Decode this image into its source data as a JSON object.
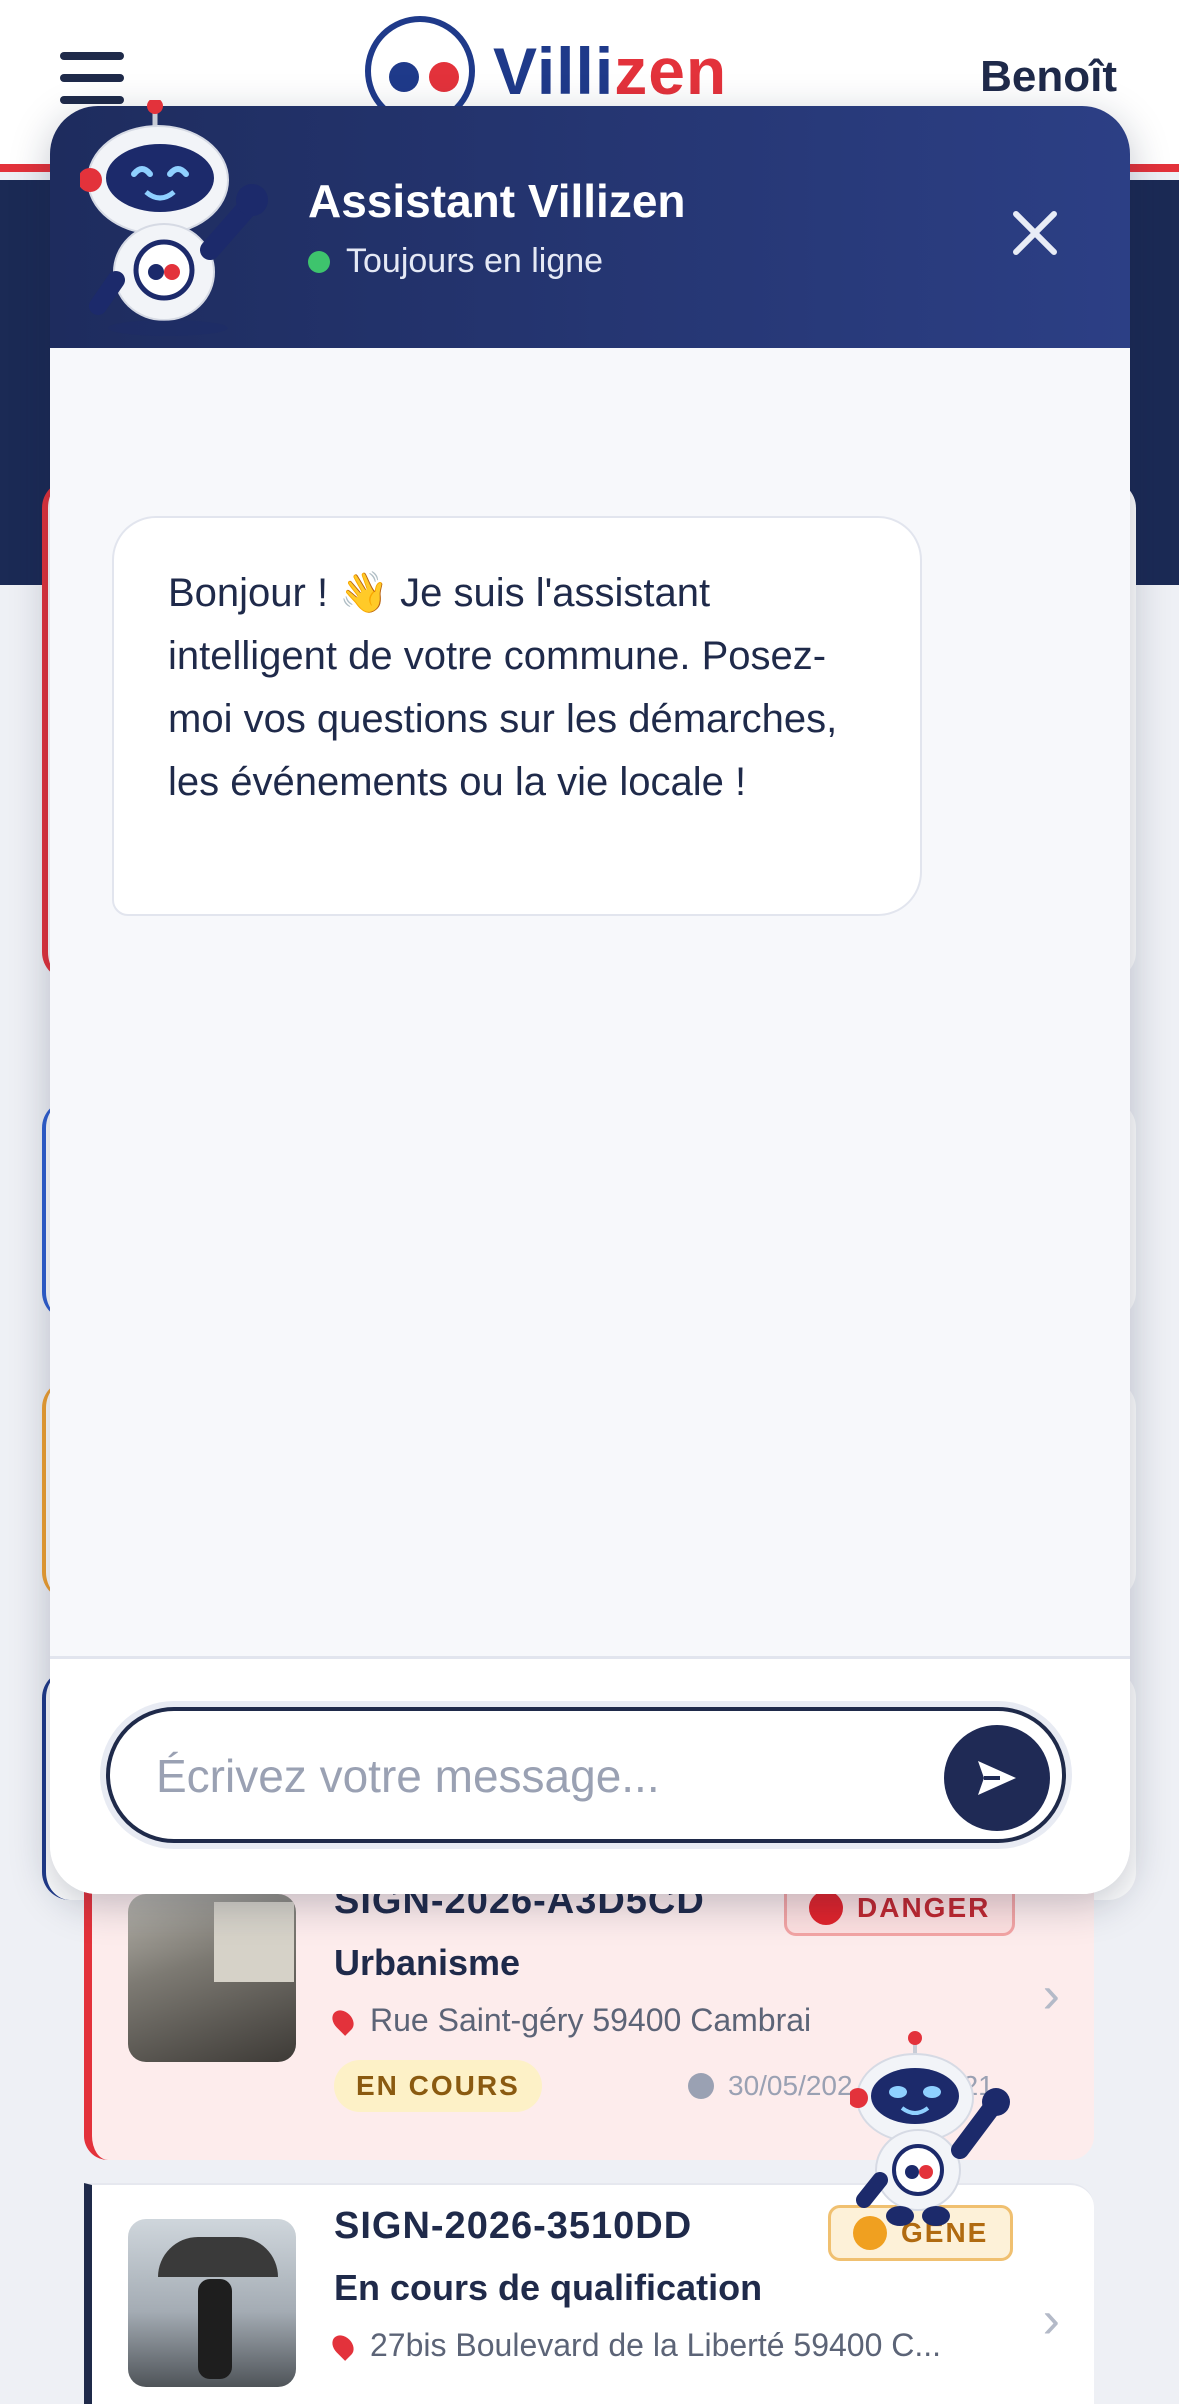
{
  "app": {
    "logo_text_a": "Villi",
    "logo_text_b": "zen",
    "username": "Benoît"
  },
  "chat": {
    "title": "Assistant Villizen",
    "status": "Toujours en ligne",
    "greeting": "Bonjour ! 👋 Je suis l'assistant intelligent de votre commune. Posez-moi vos questions sur les démarches, les événements ou la vie locale !",
    "input_placeholder": "Écrivez votre message...",
    "input_value": ""
  },
  "reports": [
    {
      "id": "SIGN-2026-A3D5CD",
      "category": "Urbanisme",
      "address": "Rue Saint-géry 59400 Cambrai",
      "status": "EN COURS",
      "date": "30/05/202",
      "date_tail": "21",
      "severity": "DANGER"
    },
    {
      "id": "SIGN-2026-3510DD",
      "category": "En cours de qualification",
      "address": "27bis Boulevard de la Liberté 59400 C...",
      "severity": "GENE"
    }
  ],
  "colors": {
    "navy": "#1f2a4a",
    "brand_red": "#e3323b",
    "online": "#3ec46d"
  },
  "icons": [
    "menu-icon",
    "close-icon",
    "send-icon",
    "pin-icon",
    "clock-icon",
    "chevron-right-icon",
    "robot-mascot"
  ]
}
